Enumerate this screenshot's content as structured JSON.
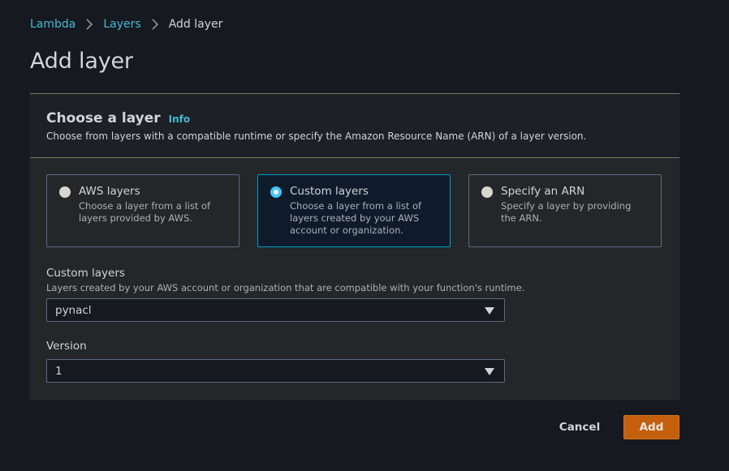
{
  "breadcrumb": {
    "items": [
      {
        "label": "Lambda",
        "link": true
      },
      {
        "label": "Layers",
        "link": true
      },
      {
        "label": "Add layer",
        "link": false
      }
    ]
  },
  "page": {
    "title": "Add layer"
  },
  "panel": {
    "title": "Choose a layer",
    "info_label": "Info",
    "description": "Choose from layers with a compatible runtime or specify the Amazon Resource Name (ARN) of a layer version.",
    "options": [
      {
        "label": "AWS layers",
        "description": "Choose a layer from a list of layers provided by AWS.",
        "selected": false
      },
      {
        "label": "Custom layers",
        "description": "Choose a layer from a list of layers created by your AWS account or organization.",
        "selected": true
      },
      {
        "label": "Specify an ARN",
        "description": "Specify a layer by providing the ARN.",
        "selected": false
      }
    ],
    "custom_layers_field": {
      "label": "Custom layers",
      "description": "Layers created by your AWS account or organization that are compatible with your function's runtime.",
      "value": "pynacl"
    },
    "version_field": {
      "label": "Version",
      "value": "1"
    }
  },
  "actions": {
    "cancel_label": "Cancel",
    "add_label": "Add"
  },
  "colors": {
    "link": "#44b9d6",
    "primary_button": "#c45f0d",
    "selected_border": "#00a1c9",
    "selected_radio": "#44c5f5"
  }
}
